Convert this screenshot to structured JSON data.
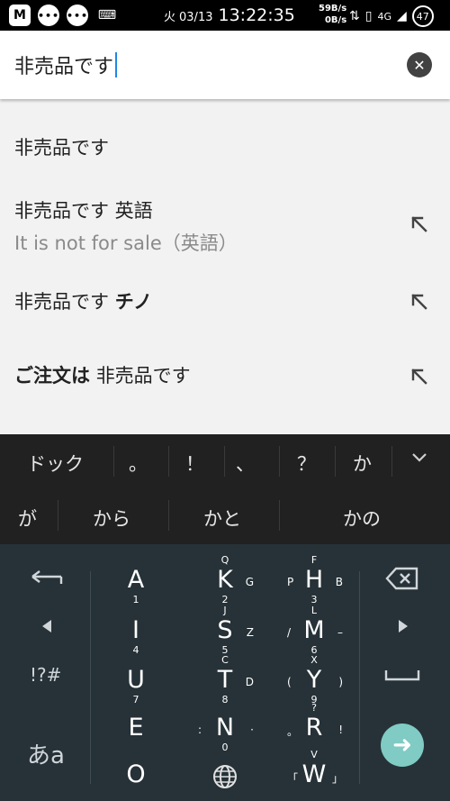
{
  "status_bar": {
    "icons": [
      "gmail-icon",
      "chat-bubble-icon",
      "chat-bubble-icon",
      "keyboard-icon"
    ],
    "day": "火",
    "date": "03/13",
    "time": "13:22:35",
    "net_up": "59B/s",
    "net_down": "0B/s",
    "signal": "4G",
    "battery": "47"
  },
  "search": {
    "query": "非売品です"
  },
  "suggestions": [
    {
      "text": "非売品です"
    },
    {
      "text": "非売品です",
      "bold": "",
      "suffix": " 英語",
      "sub": "It is not for sale（英語）"
    },
    {
      "text": "非売品です",
      "suffix_bold": "チノ"
    },
    {
      "prefix_bold": "ご注文は",
      "text": "非売品です"
    }
  ],
  "candidates": {
    "row1": [
      "ドック",
      "。",
      "！",
      "、",
      "？",
      "か"
    ],
    "row2": [
      "が",
      "から",
      "かと",
      "かの"
    ]
  },
  "keyboard": {
    "keys": [
      {
        "main": "A",
        "down": "1"
      },
      {
        "main": "K",
        "up": "Q",
        "down": "2",
        "rt": "G"
      },
      {
        "main": "H",
        "up": "F",
        "down": "3",
        "lt": "P",
        "rt": "B"
      },
      {
        "main": "I",
        "down": "4"
      },
      {
        "main": "S",
        "up": "J",
        "down": "5",
        "rt": "Z"
      },
      {
        "main": "M",
        "up": "L",
        "down": "6",
        "lt": "/",
        "rt": "–"
      },
      {
        "main": "U",
        "down": "7"
      },
      {
        "main": "T",
        "up": "C",
        "down": "8",
        "rt": "D"
      },
      {
        "main": "Y",
        "up": "X",
        "down": "9",
        "lt": "(",
        "rt": ")"
      },
      {
        "main": "E",
        "down": ""
      },
      {
        "main": "N",
        "up": "",
        "down": "0",
        "lt": ":",
        "rt": "·"
      },
      {
        "main": "R",
        "up": "?",
        "down": "",
        "lt": "。",
        "rt": "!"
      },
      {
        "main": "O",
        "down": ""
      },
      {
        "main": "W",
        "up": "V",
        "down": "",
        "lt": "「",
        "rt": "」"
      }
    ],
    "left_symbols": "!?#",
    "mode_label": "あa"
  }
}
